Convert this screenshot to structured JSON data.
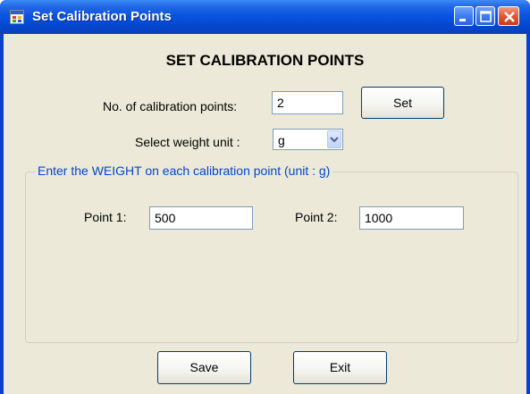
{
  "window": {
    "title": "Set Calibration Points",
    "app_icon": "form-icon",
    "controls": [
      "minimize-icon",
      "maximize-icon",
      "close-icon"
    ]
  },
  "form": {
    "heading": "SET CALIBRATION POINTS",
    "num_points_label": "No. of calibration points:",
    "num_points_value": "2",
    "set_button": "Set",
    "weight_unit_label": "Select weight unit :",
    "weight_unit_value": "g"
  },
  "group": {
    "legend": "Enter the WEIGHT on each calibration point (unit : g)",
    "points": [
      {
        "label": "Point 1:",
        "value": "500"
      },
      {
        "label": "Point 2:",
        "value": "1000"
      }
    ]
  },
  "footer": {
    "save_button": "Save",
    "exit_button": "Exit"
  },
  "colors": {
    "title_bar": "#0a55e0",
    "client_background": "#ece9d8",
    "group_legend": "#0046d5",
    "close_button": "#e2573a"
  }
}
